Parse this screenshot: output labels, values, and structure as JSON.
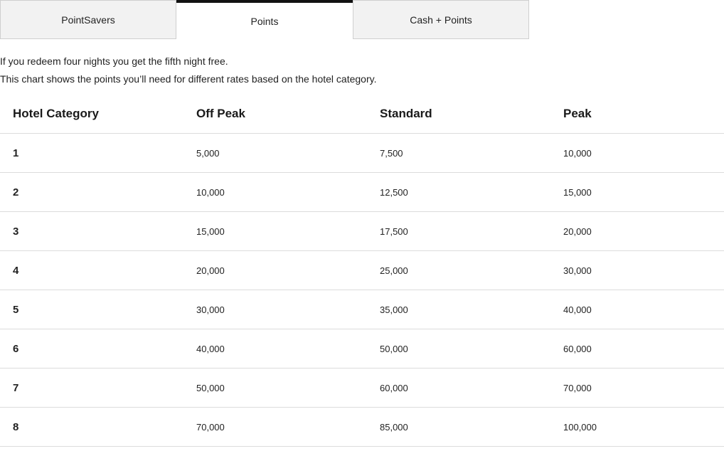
{
  "tabs": [
    {
      "label": "PointSavers",
      "active": false
    },
    {
      "label": "Points",
      "active": true
    },
    {
      "label": "Cash + Points",
      "active": false
    }
  ],
  "intro": {
    "line1": "If you redeem four nights you get the fifth night free.",
    "line2": "This chart shows the points you’ll need for different rates based on the hotel category."
  },
  "table": {
    "headers": [
      "Hotel Category",
      "Off Peak",
      "Standard",
      "Peak"
    ],
    "rows": [
      [
        "1",
        "5,000",
        "7,500",
        "10,000"
      ],
      [
        "2",
        "10,000",
        "12,500",
        "15,000"
      ],
      [
        "3",
        "15,000",
        "17,500",
        "20,000"
      ],
      [
        "4",
        "20,000",
        "25,000",
        "30,000"
      ],
      [
        "5",
        "30,000",
        "35,000",
        "40,000"
      ],
      [
        "6",
        "40,000",
        "50,000",
        "60,000"
      ],
      [
        "7",
        "50,000",
        "60,000",
        "70,000"
      ],
      [
        "8",
        "70,000",
        "85,000",
        "100,000"
      ]
    ]
  },
  "colors": {
    "tab_background": "#f2f2f2",
    "tab_border": "#cfcfcf",
    "active_tab_indicator": "#111111",
    "row_divider": "#dcdcdc"
  }
}
